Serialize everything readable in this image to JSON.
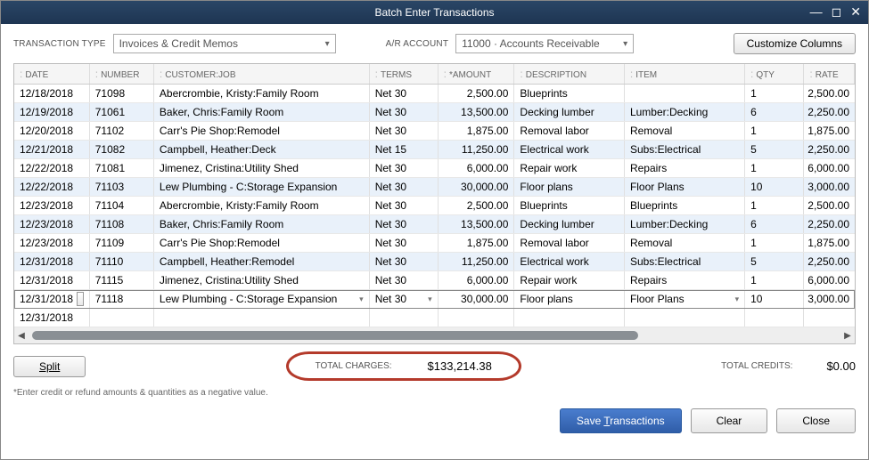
{
  "window": {
    "title": "Batch Enter Transactions"
  },
  "toolbar": {
    "type_label": "TRANSACTION TYPE",
    "type_value": "Invoices & Credit Memos",
    "ar_label": "A/R ACCOUNT",
    "ar_value": "11000 · Accounts Receivable",
    "customize": "Customize Columns"
  },
  "columns": {
    "date": "DATE",
    "number": "NUMBER",
    "customer": "CUSTOMER:JOB",
    "terms": "TERMS",
    "amount": "*AMOUNT",
    "desc": "DESCRIPTION",
    "item": "ITEM",
    "qty": "QTY",
    "rate": "RATE"
  },
  "rows": [
    {
      "date": "12/18/2018",
      "number": "71098",
      "customer": "Abercrombie, Kristy:Family Room",
      "terms": "Net 30",
      "amount": "2,500.00",
      "desc": "Blueprints",
      "item": "",
      "qty": "1",
      "rate": "2,500.00"
    },
    {
      "date": "12/19/2018",
      "number": "71061",
      "customer": "Baker, Chris:Family Room",
      "terms": "Net 30",
      "amount": "13,500.00",
      "desc": "Decking lumber",
      "item": "Lumber:Decking",
      "qty": "6",
      "rate": "2,250.00"
    },
    {
      "date": "12/20/2018",
      "number": "71102",
      "customer": "Carr's Pie Shop:Remodel",
      "terms": "Net 30",
      "amount": "1,875.00",
      "desc": "Removal labor",
      "item": "Removal",
      "qty": "1",
      "rate": "1,875.00"
    },
    {
      "date": "12/21/2018",
      "number": "71082",
      "customer": "Campbell, Heather:Deck",
      "terms": "Net 15",
      "amount": "11,250.00",
      "desc": "Electrical work",
      "item": "Subs:Electrical",
      "qty": "5",
      "rate": "2,250.00"
    },
    {
      "date": "12/22/2018",
      "number": "71081",
      "customer": "Jimenez, Cristina:Utility Shed",
      "terms": "Net 30",
      "amount": "6,000.00",
      "desc": "Repair work",
      "item": "Repairs",
      "qty": "1",
      "rate": "6,000.00"
    },
    {
      "date": "12/22/2018",
      "number": "71103",
      "customer": "Lew Plumbing - C:Storage Expansion",
      "terms": "Net 30",
      "amount": "30,000.00",
      "desc": "Floor plans",
      "item": "Floor Plans",
      "qty": "10",
      "rate": "3,000.00"
    },
    {
      "date": "12/23/2018",
      "number": "71104",
      "customer": "Abercrombie, Kristy:Family Room",
      "terms": "Net 30",
      "amount": "2,500.00",
      "desc": "Blueprints",
      "item": "Blueprints",
      "qty": "1",
      "rate": "2,500.00"
    },
    {
      "date": "12/23/2018",
      "number": "71108",
      "customer": "Baker, Chris:Family Room",
      "terms": "Net 30",
      "amount": "13,500.00",
      "desc": "Decking lumber",
      "item": "Lumber:Decking",
      "qty": "6",
      "rate": "2,250.00"
    },
    {
      "date": "12/23/2018",
      "number": "71109",
      "customer": "Carr's Pie Shop:Remodel",
      "terms": "Net 30",
      "amount": "1,875.00",
      "desc": "Removal labor",
      "item": "Removal",
      "qty": "1",
      "rate": "1,875.00"
    },
    {
      "date": "12/31/2018",
      "number": "71110",
      "customer": "Campbell, Heather:Remodel",
      "terms": "Net 30",
      "amount": "11,250.00",
      "desc": "Electrical work",
      "item": "Subs:Electrical",
      "qty": "5",
      "rate": "2,250.00"
    },
    {
      "date": "12/31/2018",
      "number": "71115",
      "customer": "Jimenez, Cristina:Utility Shed",
      "terms": "Net 30",
      "amount": "6,000.00",
      "desc": "Repair work",
      "item": "Repairs",
      "qty": "1",
      "rate": "6,000.00"
    },
    {
      "date": "12/31/2018",
      "number": "71118",
      "customer": "Lew Plumbing - C:Storage Expansion",
      "terms": "Net 30",
      "amount": "30,000.00",
      "desc": "Floor plans",
      "item": "Floor Plans",
      "qty": "10",
      "rate": "3,000.00",
      "selected": true
    },
    {
      "date": "12/31/2018",
      "number": "",
      "customer": "",
      "terms": "",
      "amount": "",
      "desc": "",
      "item": "",
      "qty": "",
      "rate": ""
    }
  ],
  "totals": {
    "charges_label": "TOTAL CHARGES:",
    "charges_value": "$133,214.38",
    "credits_label": "TOTAL CREDITS:",
    "credits_value": "$0.00"
  },
  "footnote": "*Enter credit or refund amounts & quantities as a negative value.",
  "buttons": {
    "split": "Split",
    "save": "Save Transactions",
    "clear": "Clear",
    "close": "Close"
  }
}
